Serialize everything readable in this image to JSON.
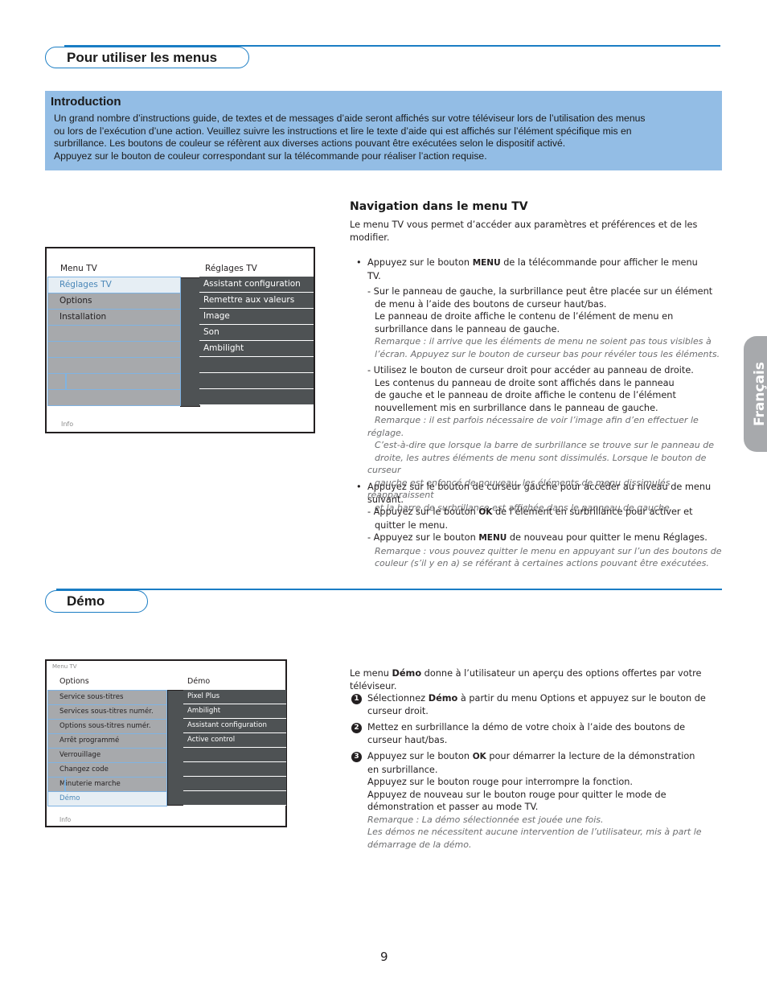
{
  "section1": {
    "title": "Pour utiliser les menus"
  },
  "intro": {
    "title": "Introduction",
    "lines": [
      "Un grand nombre d’instructions guide, de textes et de messages d’aide seront affichés sur votre téléviseur lors de l’utilisation des menus",
      "ou lors de l’exécution d’une action. Veuillez suivre les instructions et lire le texte d’aide qui est affichés sur l’élément spécifique mis en",
      "surbrillance. Les boutons de couleur se réfèrent aux diverses actions pouvant être exécutées selon le dispositif activé.",
      "Appuyez sur le bouton de couleur correspondant sur la télécommande pour réaliser l’action requise."
    ]
  },
  "menu1": {
    "left_header": "Menu TV",
    "right_header": "Réglages TV",
    "left_items": [
      "Réglages TV",
      "Options",
      "Installation",
      "",
      "",
      "",
      "",
      ""
    ],
    "selected_index": 0,
    "right_items": [
      "Assistant configuration",
      "Remettre aux valeurs",
      "Image",
      "Son",
      "Ambilight",
      "",
      "",
      ""
    ],
    "info": "Info"
  },
  "navigation": {
    "title": "Navigation dans le menu TV",
    "intro_lines": [
      "Le menu TV vous permet d’accéder aux paramètres et préférences et de les",
      "modifier."
    ],
    "bullet1": {
      "pre": "Appuyez sur le bouton ",
      "key": "MENU",
      "post": " de la télécommande pour afficher le menu",
      "line2": "TV."
    },
    "sub1": {
      "lines": [
        "- Sur le panneau de gauche, la surbrillance peut être placée sur un élément",
        "de menu à l’aide des boutons de curseur haut/bas.",
        "Le panneau de droite affiche le contenu de l’élément de menu en",
        "surbrillance dans le panneau de gauche."
      ],
      "remark": [
        "Remarque : il arrive que les éléments de menu ne soient pas tous visibles à",
        "l’écran. Appuyez sur le bouton de curseur bas pour révéler tous les éléments."
      ]
    },
    "sub2": {
      "lines": [
        "- Utilisez le bouton de curseur droit pour accéder au panneau de droite.",
        "Les contenus du panneau de droite sont affichés dans le panneau",
        "de gauche et le panneau de droite affiche le contenu de l’élément",
        "nouvellement mis en surbrillance dans le panneau de gauche."
      ],
      "remark": [
        "Remarque : il est parfois nécessaire de voir l’image afin d’en effectuer le réglage.",
        "C’est-à-dire que lorsque la barre de surbrillance se trouve sur le panneau de",
        "droite, les autres éléments de menu sont dissimulés. Lorsque le bouton de curseur",
        "gauche est enfoncé de nouveau, les éléments de menu dissimulés réapparaissent",
        "et la barre de surbrillance est affichée dans le panneau de gauche."
      ]
    },
    "bullet2": {
      "lines": [
        "Appuyez sur le bouton de curseur gauche pour accéder au niveau de menu",
        "suivant."
      ]
    },
    "sub3": {
      "pre": "- Appuyez sur le bouton ",
      "key": "OK",
      "post": " de l’élément en surbrillance pour activer et",
      "line2": "quitter le menu."
    },
    "sub4": {
      "pre": "- Appuyez sur le bouton ",
      "key": "MENU",
      "post": " de nouveau pour quitter le menu Réglages.",
      "remark": [
        "Remarque : vous pouvez quitter le menu en appuyant sur l’un des boutons de",
        "couleur (s’il y en a) se référant à certaines actions pouvant être exécutées."
      ]
    }
  },
  "section2": {
    "title": "Démo"
  },
  "menu2": {
    "top_label": "Menu TV",
    "left_header": "Options",
    "right_header": "Démo",
    "left_items": [
      "Service sous-titres",
      "Services sous-titres numér.",
      "Options sous-titres numér.",
      "Arrêt programmé",
      "Verrouillage",
      "Changez code",
      "Minuterie marche",
      "Démo"
    ],
    "selected_index": 7,
    "right_items": [
      "Pixel Plus",
      "Ambilight",
      "Assistant configuration",
      "Active control",
      "",
      "",
      "",
      ""
    ],
    "info": "Info"
  },
  "demo": {
    "intro": {
      "pre": "Le menu ",
      "key": "Démo",
      "post": " donne à l’utilisateur un aperçu des options offertes par votre",
      "line2": "téléviseur."
    },
    "step1": {
      "num": "1",
      "pre": "Sélectionnez ",
      "key": "Démo",
      "post": " à partir du menu Options et appuyez sur le bouton de",
      "line2": "curseur droit."
    },
    "step2": {
      "num": "2",
      "lines": [
        "Mettez en surbrillance la démo de votre choix à l’aide des boutons de",
        "curseur haut/bas."
      ]
    },
    "step3": {
      "num": "3",
      "pre": "Appuyez sur le bouton ",
      "key": "OK",
      "post": " pour démarrer la lecture de la démonstration",
      "lines": [
        "en surbrillance.",
        "Appuyez sur le bouton rouge pour interrompre la fonction.",
        "Appuyez de nouveau sur le bouton rouge pour quitter le mode de",
        "démonstration et passer au mode TV."
      ],
      "remark": [
        "Remarque : La démo sélectionnée est jouée une fois.",
        "Les démos ne nécessitent aucune intervention de l’utilisateur, mis à part le",
        "démarrage de la démo."
      ]
    }
  },
  "side_tab": {
    "label": "Français"
  },
  "page_number": "9"
}
